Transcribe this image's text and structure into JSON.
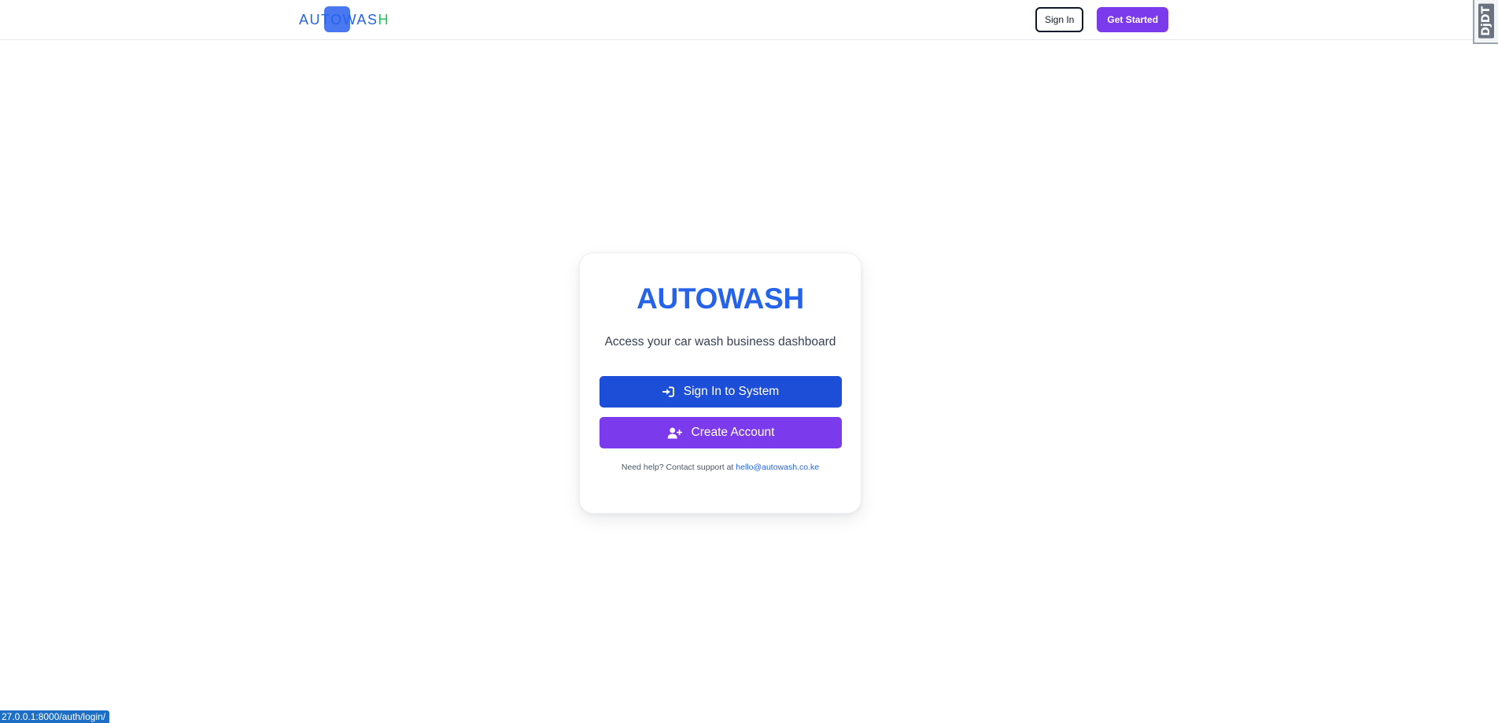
{
  "header": {
    "logo": {
      "text_part1": "AUTOWAS",
      "text_part2": "H"
    },
    "signin_label": "Sign In",
    "get_started_label": "Get Started"
  },
  "debug_toolbar": {
    "label": "DjDT"
  },
  "card": {
    "title": "AUTOWASH",
    "subtitle": "Access your car wash business dashboard",
    "signin_button_label": "Sign In to System",
    "create_button_label": "Create Account",
    "help_text": "Need help? Contact support at",
    "help_email": "hello@autowash.co.ke"
  },
  "status_bar": {
    "url": "27.0.0.1:8000/auth/login/"
  },
  "colors": {
    "primary_blue": "#1d4ed8",
    "brand_blue": "#2563eb",
    "brand_purple": "#7c3aed",
    "brand_green": "#22c55e"
  },
  "icons": {
    "signin": "sign-in-arrow-icon",
    "create": "user-plus-icon"
  }
}
